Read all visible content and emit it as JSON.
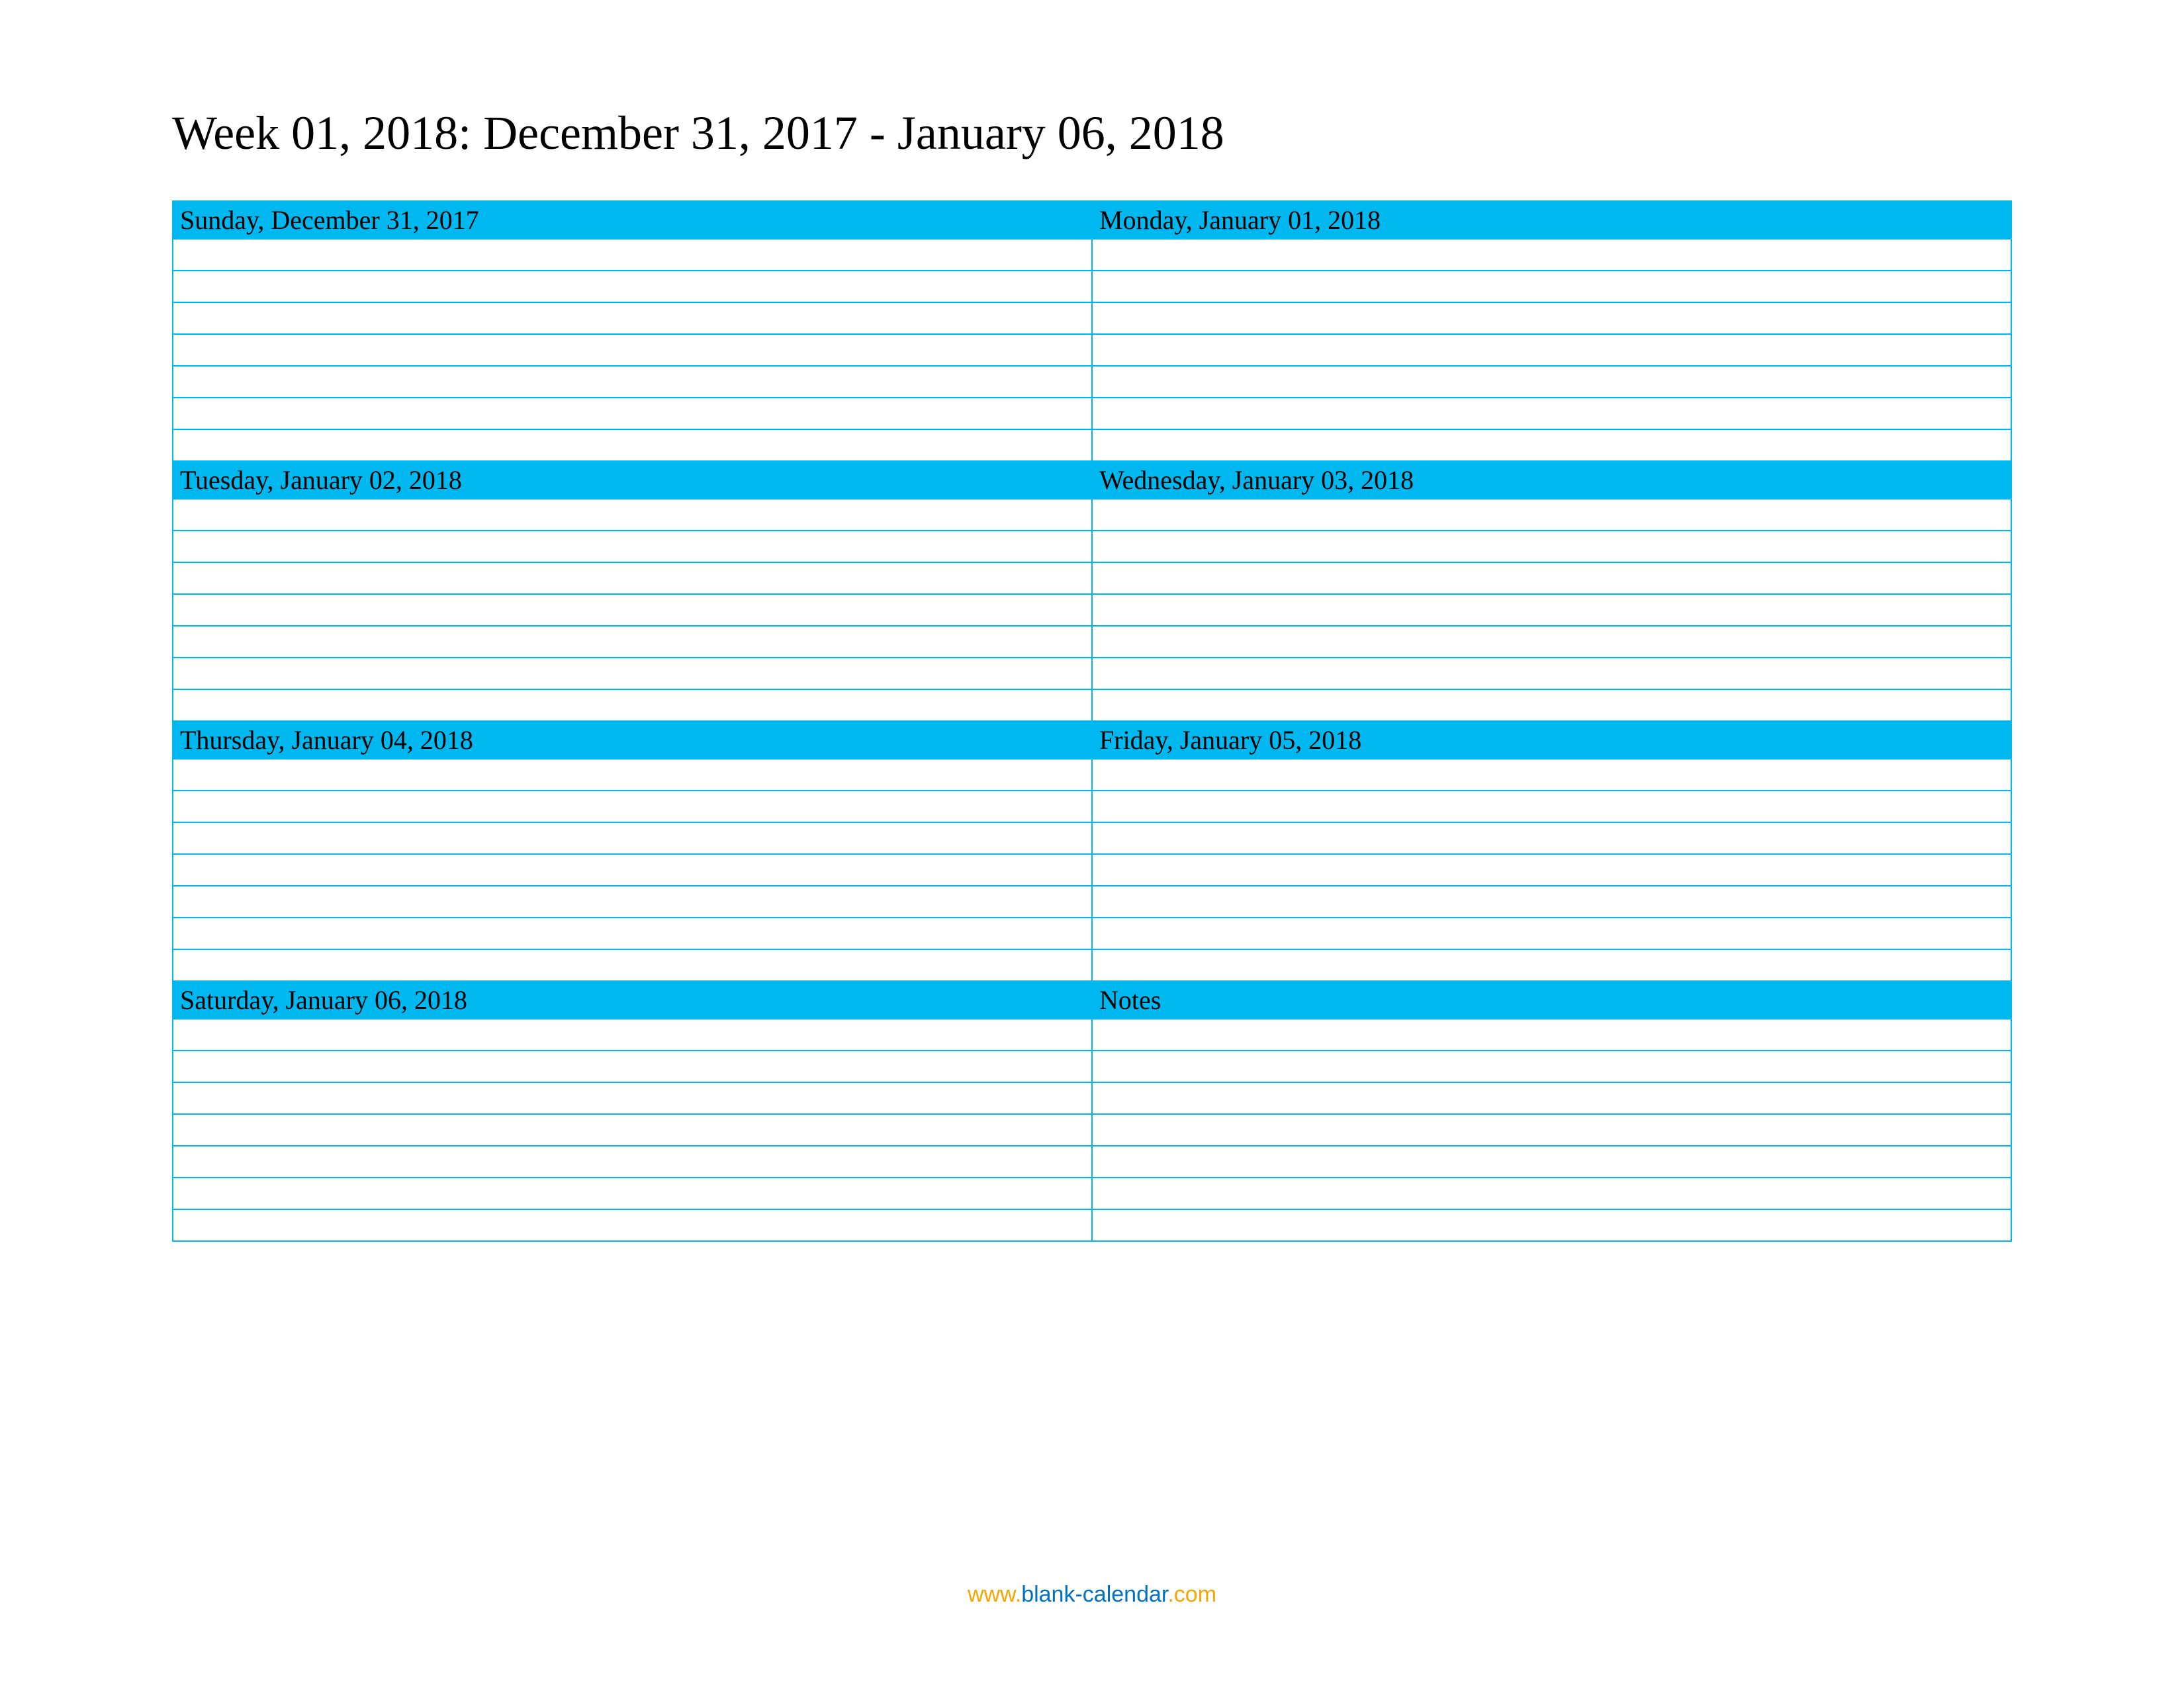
{
  "title": "Week 01, 2018: December 31, 2017 - January 06, 2018",
  "rows": [
    {
      "left_header": "Sunday, December 31, 2017",
      "right_header": "Monday, January 01, 2018"
    },
    {
      "left_header": "Tuesday, January 02, 2018",
      "right_header": "Wednesday, January 03, 2018"
    },
    {
      "left_header": "Thursday, January 04, 2018",
      "right_header": "Friday, January 05, 2018"
    },
    {
      "left_header": "Saturday, January 06, 2018",
      "right_header": "Notes"
    }
  ],
  "blank_lines_per_section": 7,
  "footer": {
    "www": "www.",
    "domain": "blank-calendar",
    "com": ".com"
  }
}
